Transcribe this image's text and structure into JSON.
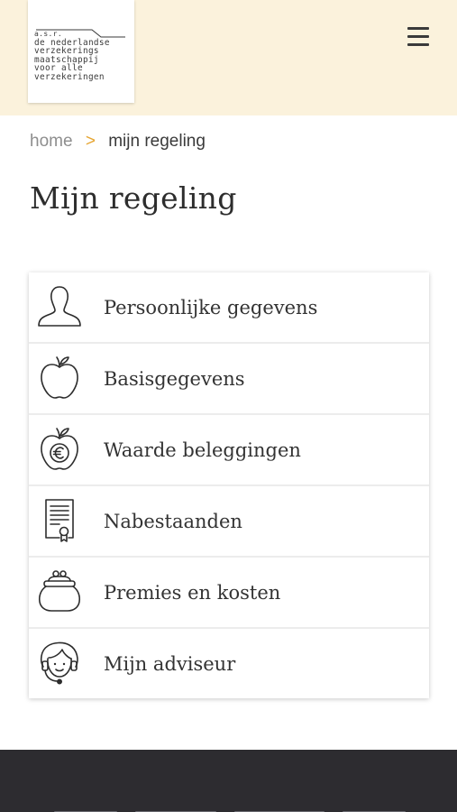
{
  "header": {
    "logo_small": "a.s.r.",
    "logo_lines": [
      "de nederlandse",
      "verzekerings",
      "maatschappij",
      "voor alle",
      "verzekeringen"
    ],
    "logo_icon": "asr-logo-mark",
    "menu_icon": "hamburger-menu-icon"
  },
  "breadcrumb": {
    "home": "home",
    "separator": ">",
    "current": "mijn regeling"
  },
  "page": {
    "title": "Mijn regeling"
  },
  "menu": [
    {
      "label": "Persoonlijke gegevens",
      "icon": "person-icon"
    },
    {
      "label": "Basisgegevens",
      "icon": "apple-icon"
    },
    {
      "label": "Waarde beleggingen",
      "icon": "apple-euro-icon"
    },
    {
      "label": "Nabestaanden",
      "icon": "certificate-icon"
    },
    {
      "label": "Premies en kosten",
      "icon": "purse-icon"
    },
    {
      "label": "Mijn adviseur",
      "icon": "advisor-headset-icon"
    }
  ],
  "colors": {
    "header_bg": "#fbf2dc",
    "accent": "#e6a531",
    "footer_bg": "#2d2c30",
    "text": "#333333"
  }
}
